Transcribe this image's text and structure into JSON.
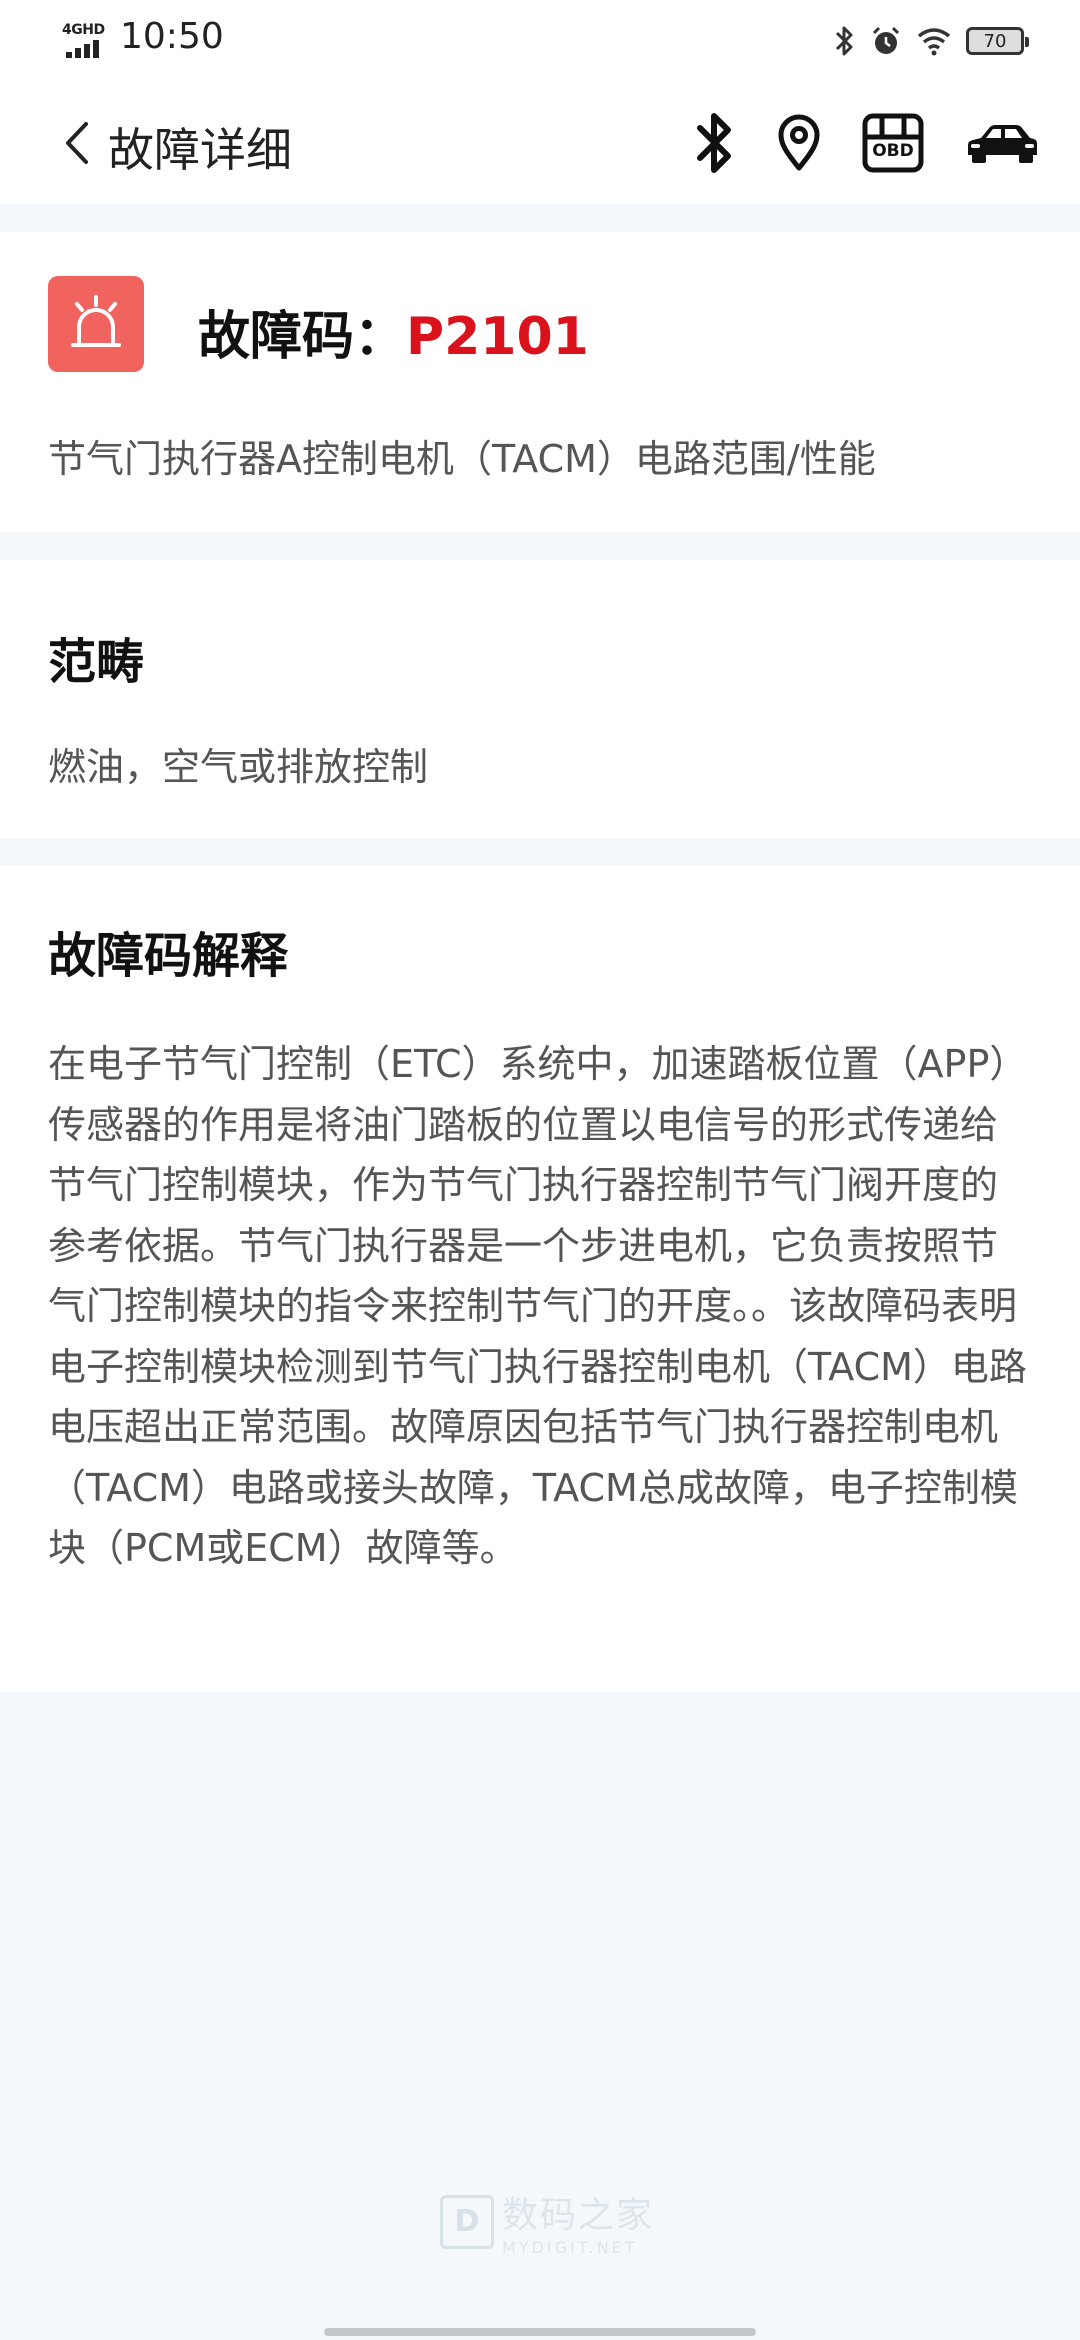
{
  "status_bar": {
    "network": "4GHD",
    "time": "10:50",
    "battery": "70"
  },
  "header": {
    "title": "故障详细",
    "obd_label": "OBD"
  },
  "fault": {
    "label": "故障码：",
    "code": "P2101",
    "description": "节气门执行器A控制电机（TACM）电路范围/性能"
  },
  "category": {
    "title": "范畴",
    "text": "燃油，空气或排放控制"
  },
  "explanation": {
    "title": "故障码解释",
    "text": "在电子节气门控制（ETC）系统中，加速踏板位置（APP）传感器的作用是将油门踏板的位置以电信号的形式传递给节气门控制模块，作为节气门执行器控制节气门阀开度的参考依据。节气门执行器是一个步进电机，它负责按照节气门控制模块的指令来控制节气门的开度。。该故障码表明电子控制模块检测到节气门执行器控制电机（TACM）电路电压超出正常范围。故障原因包括节气门执行器控制电机（TACM）电路或接头故障，TACM总成故障，电子控制模块（PCM或ECM）故障等。"
  },
  "watermark": {
    "name": "数码之家",
    "sub": "MYDIGIT.NET"
  },
  "colors": {
    "fault_code": "#d9121b",
    "alarm_badge": "#f0635f",
    "page_bg": "#f4f8fb"
  }
}
